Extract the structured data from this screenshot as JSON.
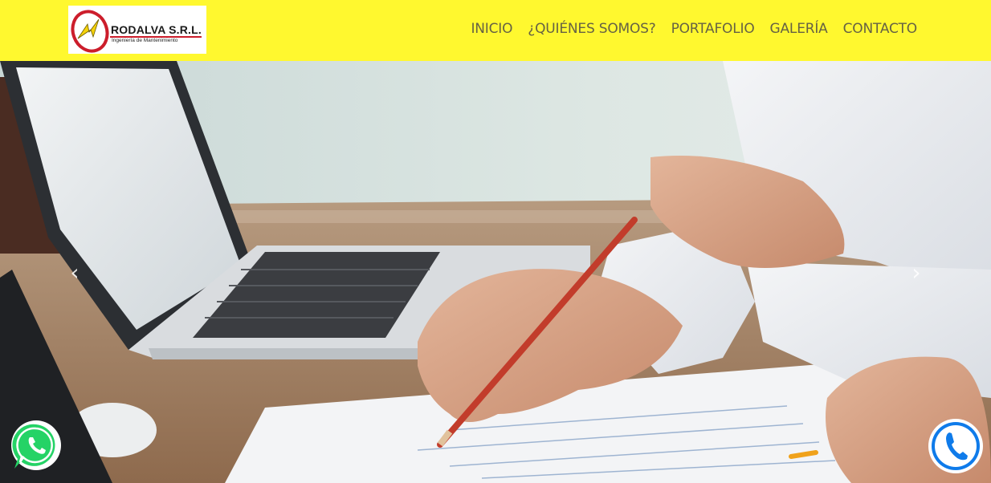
{
  "brand": {
    "name": "RODALVA S.R.L.",
    "tagline": "Ingeniería de Mantenimiento",
    "colors": {
      "navbar": "#fff82f",
      "logo_red": "#cc1d2b",
      "logo_yellow": "#f5d20a"
    }
  },
  "nav": {
    "items": [
      {
        "label": "INICIO"
      },
      {
        "label": "¿QUIÉNES SOMOS?"
      },
      {
        "label": "PORTAFOLIO"
      },
      {
        "label": "GALERÍA"
      },
      {
        "label": "CONTACTO"
      }
    ]
  },
  "carousel": {
    "prev_icon": "chevron-left-icon",
    "next_icon": "chevron-right-icon",
    "prev_glyph": "‹",
    "next_glyph": "›"
  },
  "floating": {
    "whatsapp_icon": "whatsapp-icon",
    "call_icon": "phone-icon",
    "whatsapp_color": "#25d366",
    "call_color": "#0f7bea"
  }
}
